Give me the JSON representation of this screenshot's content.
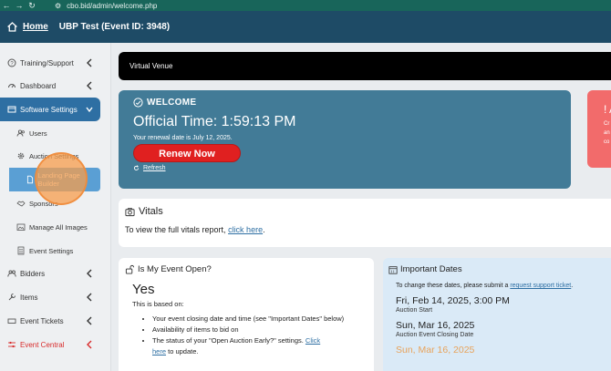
{
  "browser": {
    "url": "cbo.bid/admin/welcome.php"
  },
  "header": {
    "home_label": "Home",
    "event_title": "UBP Test (Event ID: 3948)"
  },
  "sidebar": {
    "items": [
      {
        "label": "Training/Support",
        "icon": "help-circle-icon"
      },
      {
        "label": "Dashboard",
        "icon": "dashboard-icon"
      },
      {
        "label": "Software Settings",
        "icon": "settings-icon"
      },
      {
        "label": "Users",
        "icon": "users-icon"
      },
      {
        "label": "Auction Settings",
        "icon": "gear-icon"
      },
      {
        "label": "Landing Page Builder",
        "icon": "page-icon"
      },
      {
        "label": "Sponsors",
        "icon": "handshake-icon"
      },
      {
        "label": "Manage All Images",
        "icon": "image-icon"
      },
      {
        "label": "Event Settings",
        "icon": "list-icon"
      },
      {
        "label": "Bidders",
        "icon": "people-icon"
      },
      {
        "label": "Items",
        "icon": "wrench-icon"
      },
      {
        "label": "Event Tickets",
        "icon": "ticket-icon"
      },
      {
        "label": "Event Central",
        "icon": "sliders-icon"
      }
    ]
  },
  "venue": {
    "label": "Virtual Venue"
  },
  "welcome": {
    "heading": "WELCOME",
    "official_time": "Official Time: 1:59:13 PM",
    "renewal_text": "Your renewal date is July 12, 2025.",
    "renew_label": "Renew Now",
    "refresh_label": "Refresh"
  },
  "alert": {
    "mark": "! A",
    "lines": [
      "Cr",
      "an",
      "co"
    ]
  },
  "vitals": {
    "heading": "Vitals",
    "text": "To view the full vitals report,",
    "link": "click here",
    "after": "."
  },
  "open": {
    "heading": "Is My Event Open?",
    "answer": "Yes",
    "based_on": "This is based on:",
    "bullets": [
      "Your event closing date and time (see \"Important Dates\" below)",
      "Availability of items to bid on"
    ],
    "bullet3_text": "The status of your \"Open Auction Early?\" settings.",
    "bullet3_link": "Click",
    "bullet4_link": "here",
    "bullet4_text": "to update."
  },
  "dates": {
    "heading": "Important Dates",
    "note": "To change these dates, please submit a",
    "note_link": "request support ticket",
    "note_after": ".",
    "rows": [
      {
        "date": "Fri, Feb 14, 2025, 3:00 PM",
        "label": "Auction Start"
      },
      {
        "date": "Sun, Mar 16, 2025",
        "label": "Auction Event Closing Date"
      },
      {
        "date": "Sun, Mar 16, 2025",
        "label": ""
      }
    ]
  },
  "colors": {
    "header_bg": "#1e4b66",
    "active_nav": "#2e6fa3",
    "welcome_bg": "#427b97",
    "renew_red": "#e02020",
    "alert_bg": "#f26b6b",
    "dates_bg": "#daeaf7"
  }
}
